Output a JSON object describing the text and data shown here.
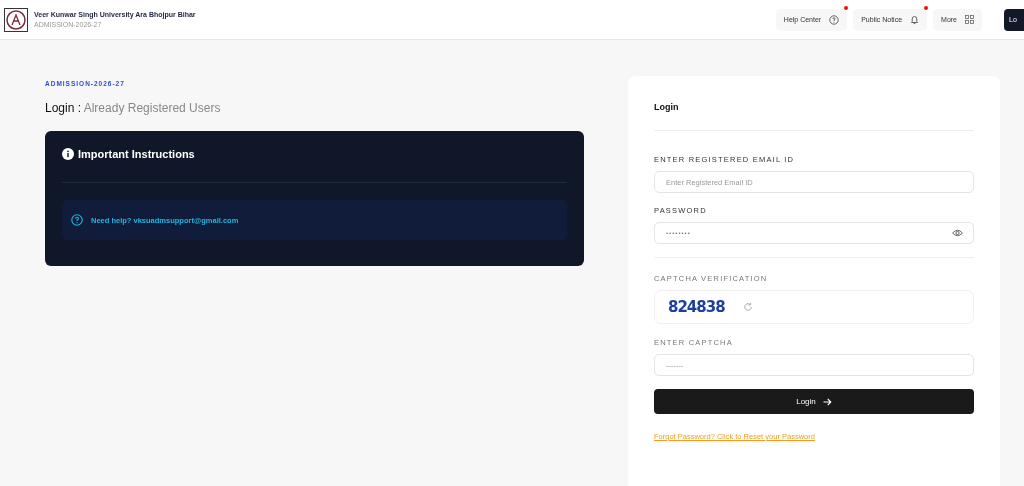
{
  "header": {
    "title": "Veer Kunwar Singh University Ara Bhojpur Bihar",
    "subtitle": "ADMISSION-2026-27",
    "nav": [
      {
        "label": "Help Center",
        "kind": "help",
        "dot": true
      },
      {
        "label": "Public Notice",
        "kind": "bell",
        "dot": true
      },
      {
        "label": "More",
        "kind": "grid",
        "dot": false
      }
    ],
    "cut_button": "Lo"
  },
  "intro": {
    "tag": "ADMISSION-2026-27",
    "heading": "Login :",
    "subheading": "Already Registered Users"
  },
  "instructions": {
    "title": "Important Instructions",
    "help_text": "Need help? vksuadmsupport@gmail.com"
  },
  "login": {
    "title": "Login",
    "fields": [
      {
        "label": "ENTER REGISTERED EMAIL ID",
        "placeholder": "Enter Registered Email ID",
        "kind": "text"
      },
      {
        "label": "PASSWORD",
        "value": "••••••••",
        "kind": "password"
      }
    ],
    "captcha": {
      "label": "CAPTCHA VERIFICATION",
      "code": "824838"
    },
    "captcha_input": {
      "label": "ENTER CAPTCHA",
      "placeholder": "-------"
    },
    "button": "Login",
    "forgot": "Forgot Password? Click to Reset your Password"
  }
}
